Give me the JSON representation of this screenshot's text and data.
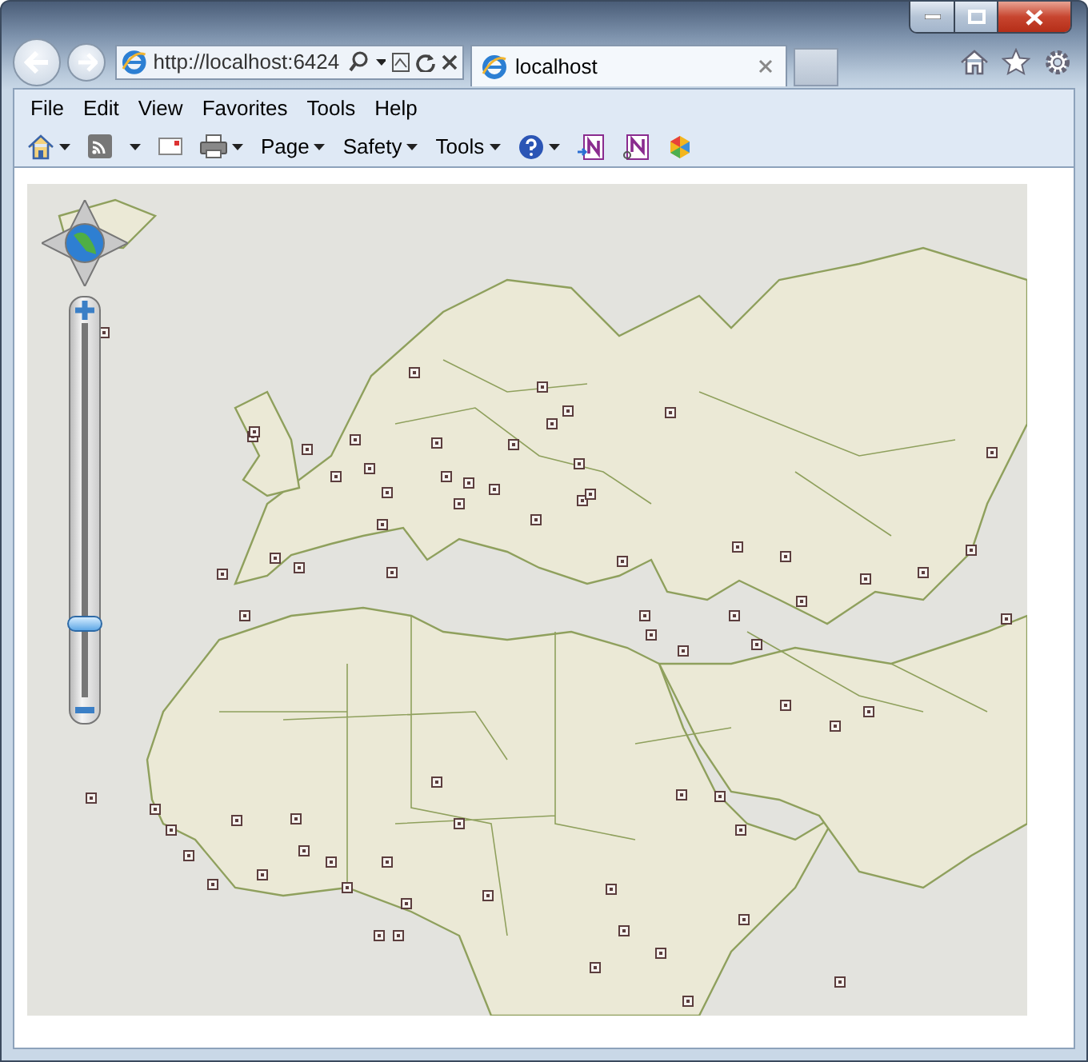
{
  "address_bar": {
    "url": "http://localhost:6424"
  },
  "tabs": [
    {
      "title": "localhost",
      "selected": true
    }
  ],
  "menu_bar": [
    "File",
    "Edit",
    "View",
    "Favorites",
    "Tools",
    "Help"
  ],
  "command_bar": [
    {
      "label": "Page"
    },
    {
      "label": "Safety"
    },
    {
      "label": "Tools"
    }
  ],
  "map": {
    "zoom_slider": {
      "level": 0.19
    }
  }
}
